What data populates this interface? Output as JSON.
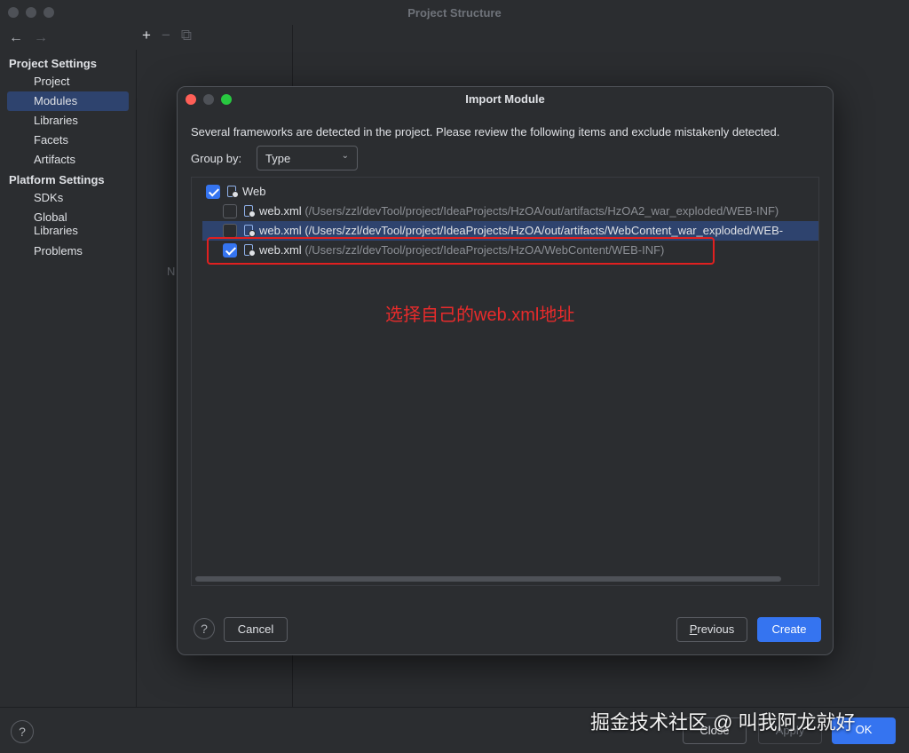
{
  "background_window": {
    "title": "Project Structure",
    "nav": {
      "back": "←",
      "forward": "→"
    },
    "sidebar": {
      "project_settings": {
        "header": "Project Settings",
        "items": [
          "Project",
          "Modules",
          "Libraries",
          "Facets",
          "Artifacts"
        ],
        "selected": "Modules"
      },
      "platform_settings": {
        "header": "Platform Settings",
        "items": [
          "SDKs",
          "Global Libraries"
        ]
      },
      "problems": "Problems"
    },
    "middle_toolbar": {
      "add": "+",
      "remove": "−",
      "copy": "⧉"
    },
    "middle_placeholder": "N",
    "footer": {
      "help": "?",
      "close_label": "Close",
      "apply_label": "Apply",
      "ok_label": "OK"
    }
  },
  "dialog": {
    "title": "Import Module",
    "description": "Several frameworks are detected in the project. Please review the following items and exclude mistakenly detected.",
    "group_by": {
      "label": "Group by:",
      "value": "Type",
      "chevron": "⌄"
    },
    "tree": {
      "root": {
        "label": "Web",
        "checked": true
      },
      "items": [
        {
          "name": "web.xml",
          "path": "(/Users/zzl/devTool/project/IdeaProjects/HzOA/out/artifacts/HzOA2_war_exploded/WEB-INF)",
          "checked": false,
          "selected": false
        },
        {
          "name": "web.xml",
          "path": "(/Users/zzl/devTool/project/IdeaProjects/HzOA/out/artifacts/WebContent_war_exploded/WEB-",
          "checked": false,
          "selected": true
        },
        {
          "name": "web.xml",
          "path": "(/Users/zzl/devTool/project/IdeaProjects/HzOA/WebContent/WEB-INF)",
          "checked": true,
          "selected": false
        }
      ]
    },
    "annotation": "选择自己的web.xml地址",
    "buttons": {
      "help": "?",
      "cancel": "Cancel",
      "previous_underlined": "P",
      "previous_rest": "revious",
      "create": "Create"
    }
  },
  "watermark": "掘金技术社区 @ 叫我阿龙就好",
  "colors": {
    "background": "#2b2d30",
    "accent": "#3574f0",
    "selection": "#2e436e",
    "annotation": "#e82b2b"
  }
}
